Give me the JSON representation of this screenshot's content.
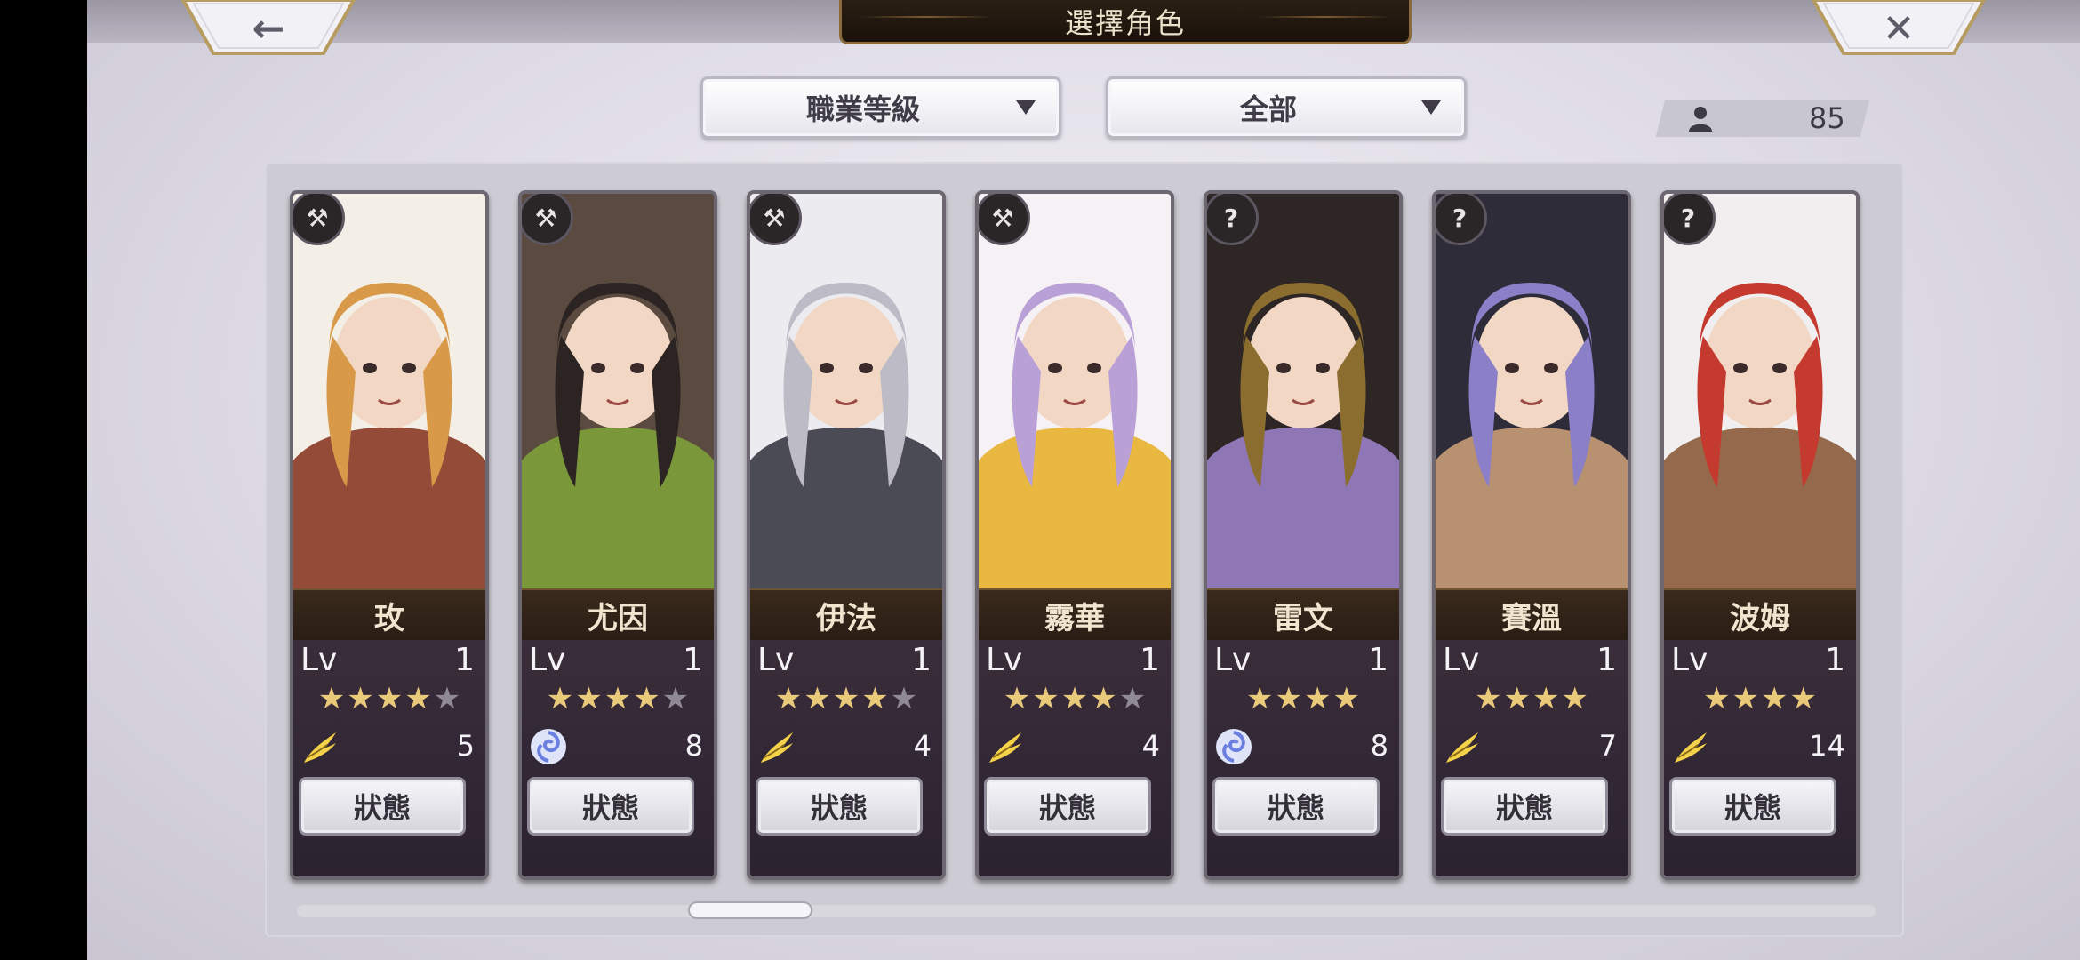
{
  "header": {
    "title": "選擇角色"
  },
  "nav": {
    "back_icon": "←",
    "close_icon": "✕"
  },
  "filters": {
    "job_label": "職業等級",
    "filter_label": "全部"
  },
  "roster": {
    "count": "85"
  },
  "lv_label": "Lv",
  "status_label": "狀態",
  "colors": {
    "gold_star": "#e9c97a",
    "grey_star": "#8f8a93",
    "wind_element": "#f4d24a",
    "water_element": "#6b7fe0"
  },
  "characters": [
    {
      "name": "玫",
      "level": "1",
      "stars": 4,
      "max_stars": 5,
      "element": "wind",
      "element_icon": "wing-icon",
      "element_value": "5",
      "class_icon": "hammer-icon",
      "palette": [
        "#f3eee6",
        "#d89a48",
        "#8a3a26"
      ]
    },
    {
      "name": "尤因",
      "level": "1",
      "stars": 4,
      "max_stars": 5,
      "element": "water",
      "element_icon": "swirl-icon",
      "element_value": "8",
      "class_icon": "hammer-icon",
      "palette": [
        "#5b4a40",
        "#2c2423",
        "#7da03a"
      ]
    },
    {
      "name": "伊法",
      "level": "1",
      "stars": 4,
      "max_stars": 5,
      "element": "wind",
      "element_icon": "wing-icon",
      "element_value": "4",
      "class_icon": "hammer-icon",
      "palette": [
        "#ecebef",
        "#bdbcc6",
        "#3a3a45"
      ]
    },
    {
      "name": "霧華",
      "level": "1",
      "stars": 4,
      "max_stars": 5,
      "element": "wind",
      "element_icon": "wing-icon",
      "element_value": "4",
      "class_icon": "hammer-icon",
      "palette": [
        "#f5f1f4",
        "#b9a0d6",
        "#e8b12e"
      ]
    },
    {
      "name": "雷文",
      "level": "1",
      "stars": 4,
      "max_stars": 4,
      "element": "water",
      "element_icon": "swirl-icon",
      "element_value": "8",
      "class_icon": "mystery-icon",
      "palette": [
        "#2d2624",
        "#8a6d2f",
        "#9a7fc4"
      ]
    },
    {
      "name": "賽溫",
      "level": "1",
      "stars": 4,
      "max_stars": 4,
      "element": "wind",
      "element_icon": "wing-icon",
      "element_value": "7",
      "class_icon": "mystery-icon",
      "palette": [
        "#2f2c3a",
        "#8b7fc8",
        "#c89c78"
      ]
    },
    {
      "name": "波姆",
      "level": "1",
      "stars": 4,
      "max_stars": 4,
      "element": "wind",
      "element_icon": "wing-icon",
      "element_value": "14",
      "class_icon": "mystery-icon",
      "palette": [
        "#f1eef0",
        "#c43a2e",
        "#8a5a3a"
      ]
    }
  ]
}
